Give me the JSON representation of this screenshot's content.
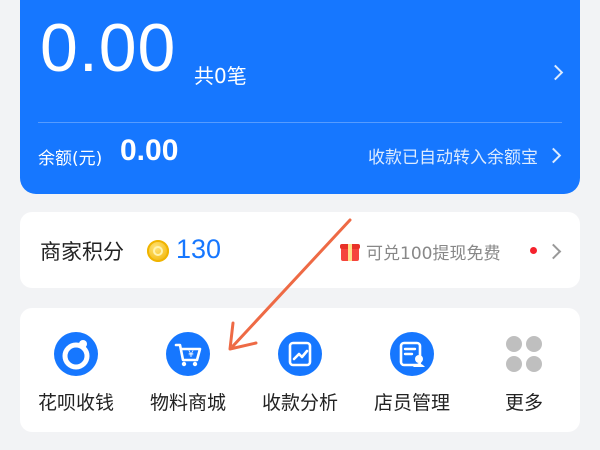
{
  "balance_card": {
    "amount": "0.00",
    "count": "共0笔",
    "balance_label": "余额(元)",
    "balance_value": "0.00",
    "auto_transfer": "收款已自动转入余额宝"
  },
  "points": {
    "label": "商家积分",
    "value": "130",
    "redeem": "可兑100提现免费"
  },
  "tools": [
    {
      "label": "花呗收钱",
      "icon": "huabei-icon"
    },
    {
      "label": "物料商城",
      "icon": "shopping-cart-yen-icon"
    },
    {
      "label": "收款分析",
      "icon": "chart-trend-icon"
    },
    {
      "label": "店员管理",
      "icon": "staff-id-icon"
    },
    {
      "label": "更多",
      "icon": "grid-dots-icon"
    }
  ],
  "colors": {
    "brand_blue": "#1677ff",
    "background": "#f2f3f5",
    "annotation_arrow": "#ee6a45",
    "notification_dot": "#f5222d",
    "more_icon_gray": "#bfbfbf"
  }
}
